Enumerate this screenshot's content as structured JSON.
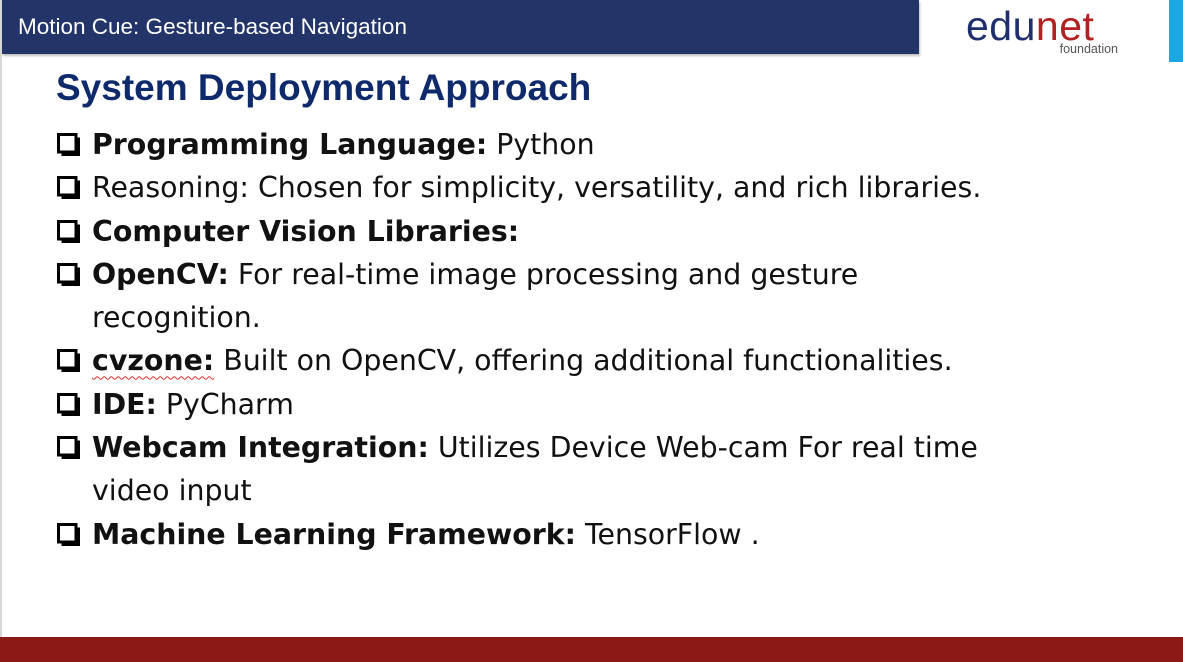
{
  "header": {
    "title": "Motion Cue: Gesture-based Navigation"
  },
  "logo": {
    "word_edu": "edu",
    "word_net": "net",
    "subtitle": "foundation"
  },
  "slide": {
    "title": "System Deployment Approach",
    "bullets": [
      {
        "label": "Programming Language:",
        "text": " Python"
      },
      {
        "label": "",
        "text": "Reasoning: Chosen for simplicity, versatility, and rich libraries."
      },
      {
        "label": "Computer Vision Libraries:",
        "text": ""
      },
      {
        "label": "OpenCV:",
        "text": " For real-time image processing and gesture recognition."
      },
      {
        "label": "cvzone:",
        "text": " Built on OpenCV, offering additional functionalities."
      },
      {
        "label": "IDE:",
        "text": " PyCharm"
      },
      {
        "label": "Webcam Integration:",
        "text": " Utilizes Device Web-cam For real time video input"
      },
      {
        "label": "Machine Learning Framework:",
        "text": " TensorFlow ."
      }
    ]
  },
  "colors": {
    "header_bg": "#233468",
    "title": "#0f2a6b",
    "footer": "#8b1a16",
    "accent": "#1ca6e2",
    "logo_edu": "#1f2f6d",
    "logo_net": "#b22222"
  },
  "icons": {
    "bullet": "checkbox-square-icon"
  }
}
